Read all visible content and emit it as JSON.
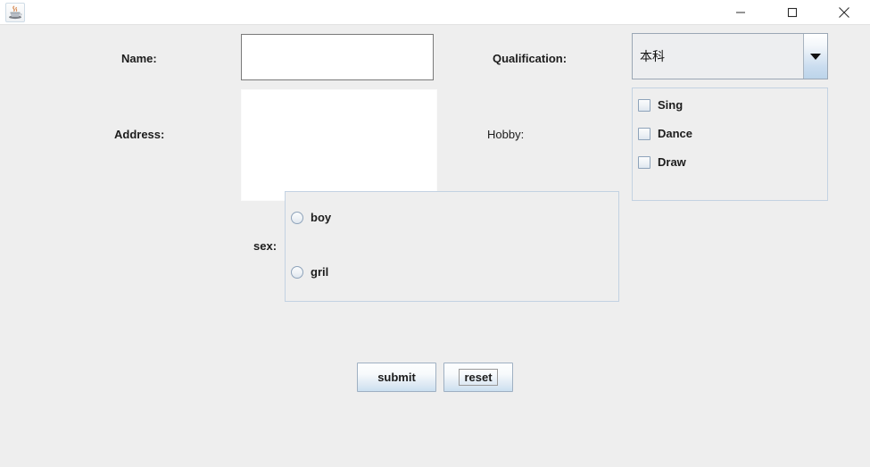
{
  "window": {
    "title": "",
    "app_icon": "java-coffee-cup-icon",
    "controls": [
      {
        "name": "minimize-button",
        "icon": "minimize-icon"
      },
      {
        "name": "maximize-button",
        "icon": "maximize-icon"
      },
      {
        "name": "close-button",
        "icon": "close-icon"
      }
    ]
  },
  "form": {
    "name": {
      "label": "Name:",
      "value": "",
      "placeholder": ""
    },
    "address": {
      "label": "Address:",
      "value": "",
      "placeholder": ""
    },
    "qualification": {
      "label": "Qualification:",
      "selected": "本科",
      "arrow_icon": "chevron-down-icon"
    },
    "hobby": {
      "label": "Hobby:",
      "options": [
        {
          "label": "Sing",
          "checked": false
        },
        {
          "label": "Dance",
          "checked": false
        },
        {
          "label": "Draw",
          "checked": false
        }
      ]
    },
    "sex": {
      "label": "sex:",
      "options": [
        {
          "label": "boy",
          "selected": false
        },
        {
          "label": "gril",
          "selected": false
        }
      ]
    }
  },
  "actions": {
    "submit_label": "submit",
    "reset_label": "reset"
  },
  "colors": {
    "background": "#eeeeee",
    "titlebar": "#ffffff",
    "field_border": "#7a7a7a",
    "panel_border": "#c3d2e2",
    "button_accent": "#cadff0",
    "control_border": "#8ea3ba"
  }
}
